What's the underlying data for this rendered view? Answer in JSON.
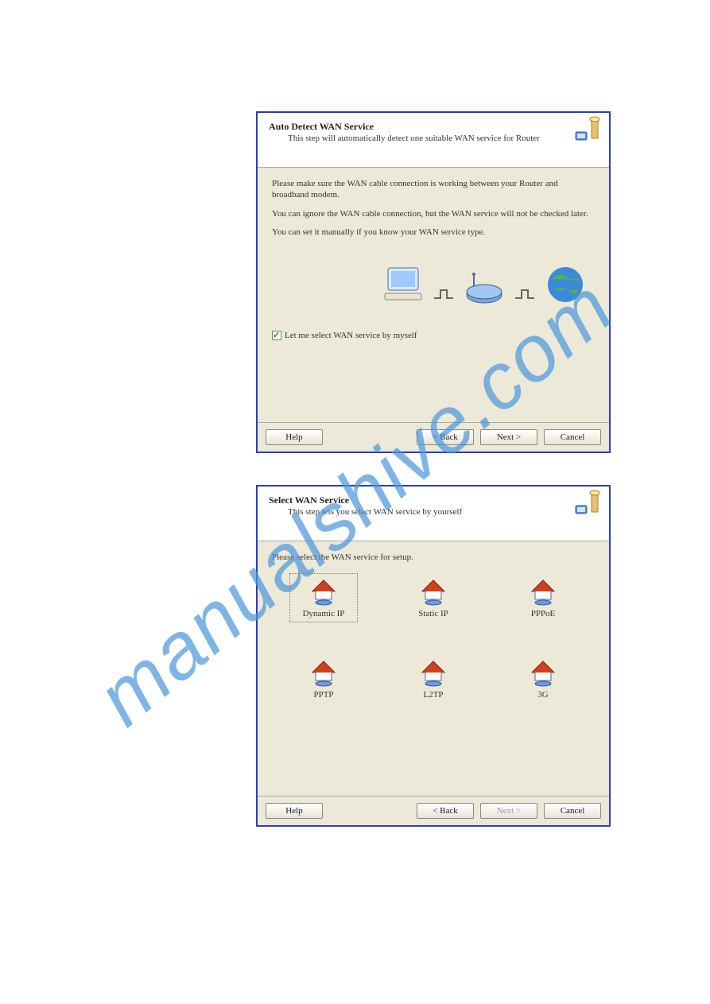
{
  "watermark": "manualshive.com",
  "dialog1": {
    "title": "Auto Detect WAN Service",
    "subtitle": "This step will automatically detect one suitable WAN service for Router",
    "para1": "Please make sure the WAN cable connection is working between your Router and broadband modem.",
    "para2": "You can ignore the WAN cable connection, but the WAN service will not be checked later.",
    "para3": "You can set it manually if you know your WAN service type.",
    "checkbox_label": "Let me select WAN service by myself",
    "btn_help": "Help",
    "btn_back": "< Back",
    "btn_next": "Next >",
    "btn_cancel": "Cancel"
  },
  "dialog2": {
    "title": "Select WAN Service",
    "subtitle": "This step lets you select WAN service by yourself",
    "prompt": "Please select the WAN service for setup.",
    "services": {
      "dynamic_ip": "Dynamic IP",
      "static_ip": "Static IP",
      "pppoe": "PPPoE",
      "pptp": "PPTP",
      "l2tp": "L2TP",
      "g3": "3G"
    },
    "btn_help": "Help",
    "btn_back": "< Back",
    "btn_next": "Next >",
    "btn_cancel": "Cancel"
  }
}
